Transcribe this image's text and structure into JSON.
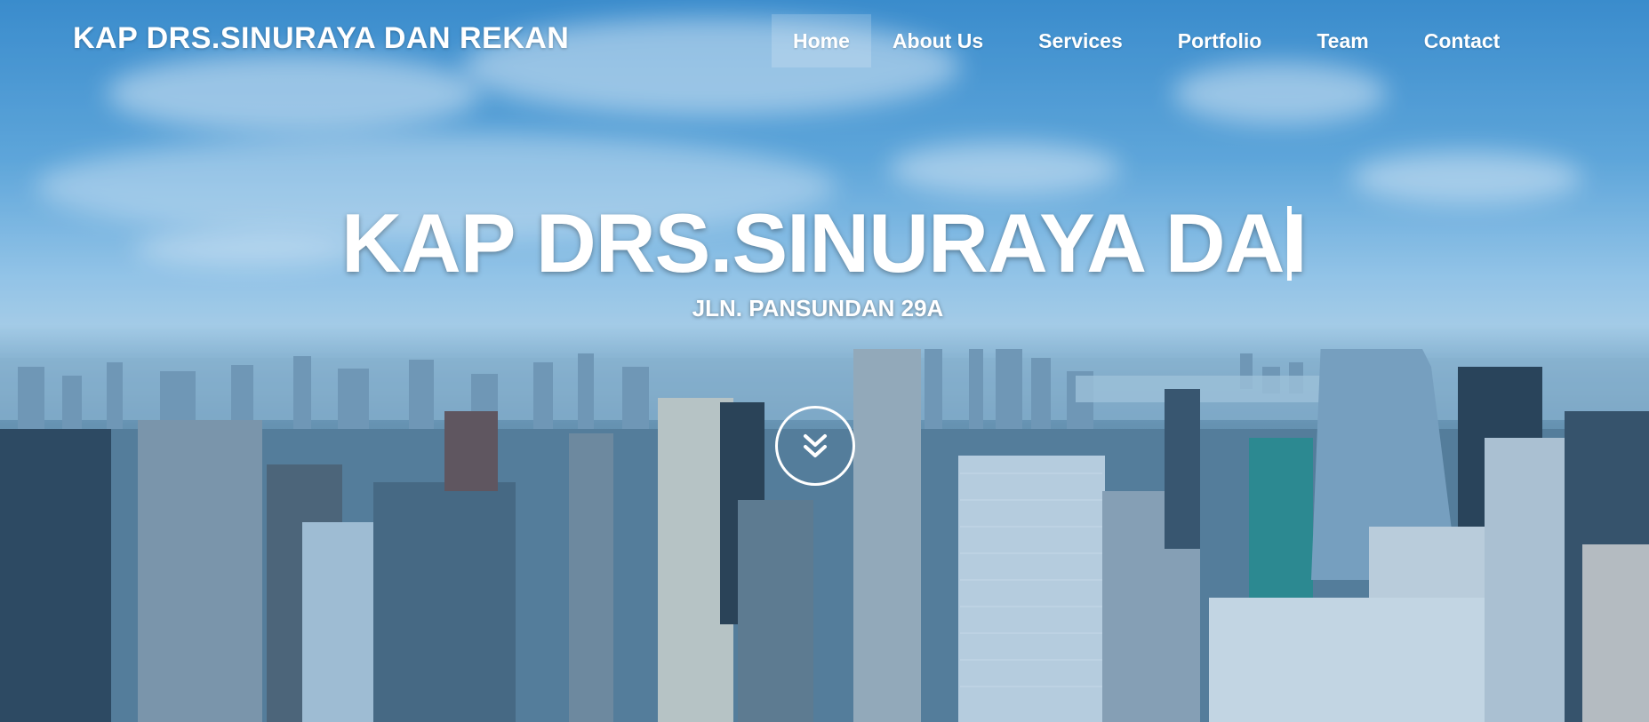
{
  "navbar": {
    "brand": "KAP DRS.SINURAYA DAN REKAN",
    "items": [
      {
        "label": "Home",
        "active": true
      },
      {
        "label": "About Us",
        "active": false
      },
      {
        "label": "Services",
        "active": false
      },
      {
        "label": "Portfolio",
        "active": false
      },
      {
        "label": "Team",
        "active": false
      },
      {
        "label": "Contact",
        "active": false
      }
    ]
  },
  "hero": {
    "title": "KAP DRS.SINURAYA DAI",
    "subtitle": "JLN. PANSUNDAN 29A",
    "scroll_icon": "double-chevron-down-icon"
  },
  "colors": {
    "text": "#ffffff",
    "sky": "#3f8fce",
    "overlay": "#2882c8"
  }
}
